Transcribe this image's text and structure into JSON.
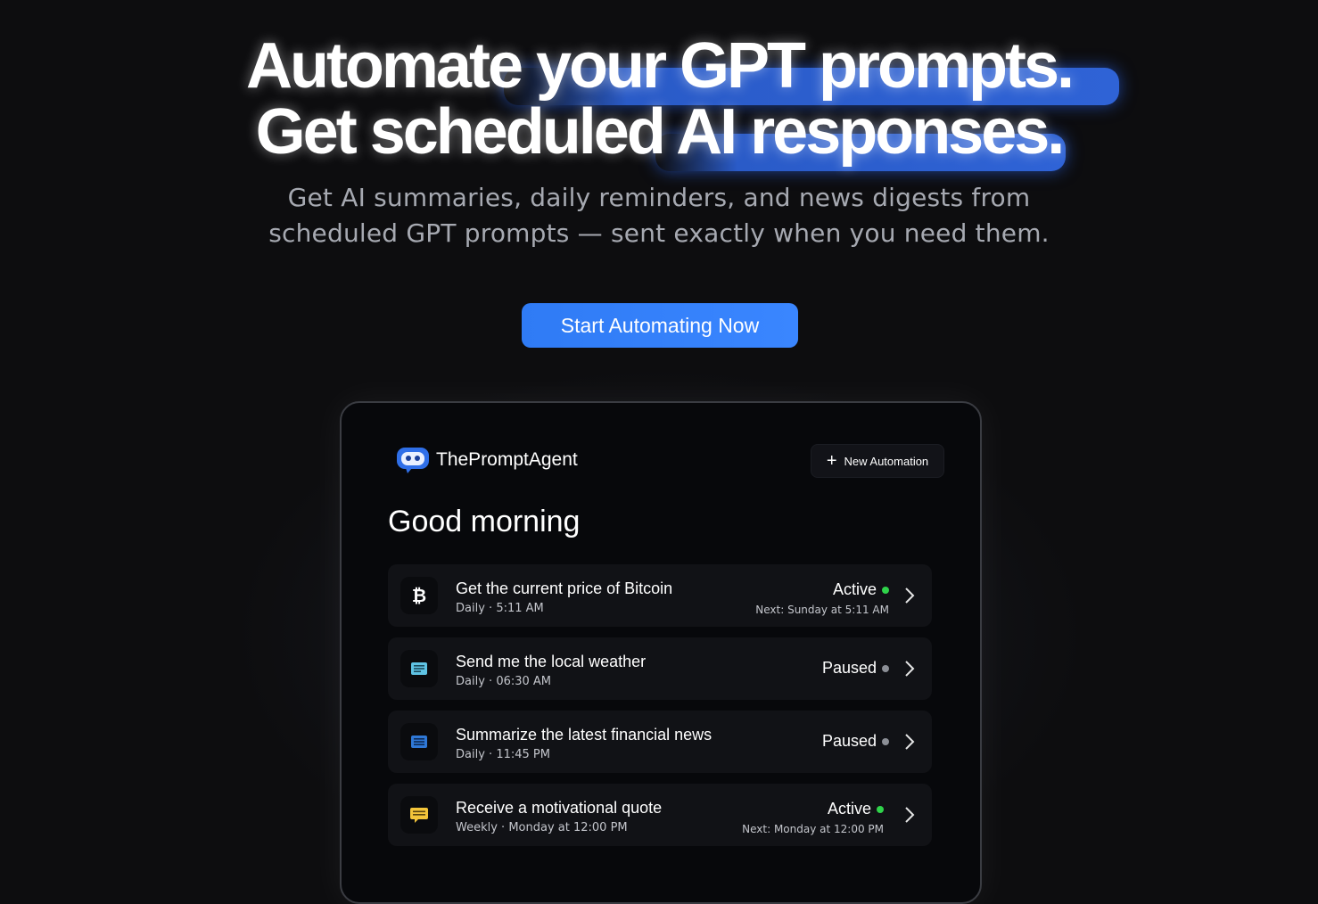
{
  "hero": {
    "headline_line1": "Automate your GPT prompts.",
    "headline_line2": "Get scheduled AI responses.",
    "subtitle_line1": "Get AI summaries, daily reminders, and news digests from",
    "subtitle_line2": "scheduled GPT prompts — sent exactly when you need them.",
    "cta_label": "Start Automating Now",
    "highlight_color": "#2f63d6",
    "cta_color": "#3a86ff"
  },
  "app": {
    "brand": "ThePromptAgent",
    "new_automation_label": "New Automation",
    "greeting": "Good morning",
    "automations": [
      {
        "icon": "bitcoin-icon",
        "title": "Get the current price of Bitcoin",
        "frequency": "Daily",
        "time": "5:11 AM",
        "status": "Active",
        "next": "Next: Sunday at 5:11 AM"
      },
      {
        "icon": "weather-icon",
        "title": "Send me the local weather",
        "frequency": "Daily",
        "time": "06:30 AM",
        "status": "Paused",
        "next": ""
      },
      {
        "icon": "news-icon",
        "title": "Summarize the latest financial news",
        "frequency": "Daily",
        "time": "11:45 PM",
        "status": "Paused",
        "next": ""
      },
      {
        "icon": "quote-icon",
        "title": "Receive a motivational quote",
        "frequency": "Weekly",
        "time": "Monday at 12:00 PM",
        "status": "Active",
        "next": "Next: Monday at 12:00 PM"
      }
    ],
    "status_colors": {
      "active": "#2fd34a",
      "paused": "#8c8f96"
    }
  }
}
